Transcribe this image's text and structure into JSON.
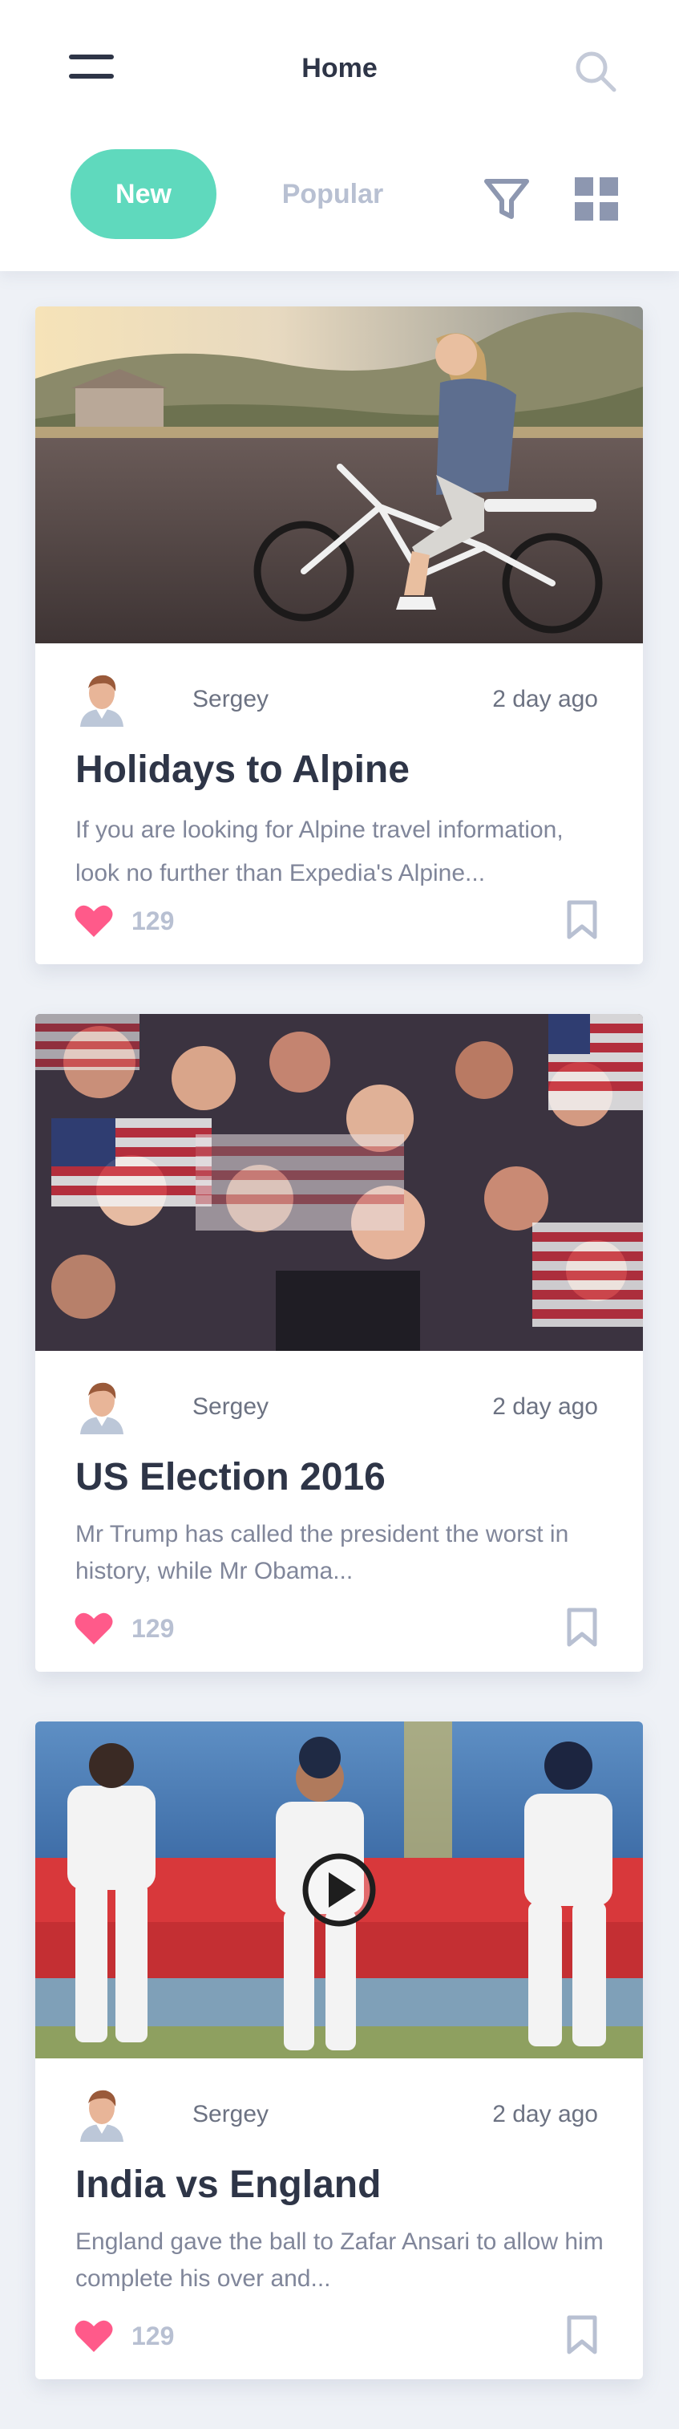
{
  "header": {
    "title": "Home",
    "menu_icon": "hamburger-menu-icon",
    "search_icon": "search-icon",
    "tabs": [
      {
        "label": "New",
        "active": true
      },
      {
        "label": "Popular",
        "active": false
      }
    ],
    "filter_icon": "filter-icon",
    "grid_icon": "grid-view-icon"
  },
  "colors": {
    "accent": "#5fd9bd",
    "heart": "#ff5a8a",
    "muted": "#b8c0d2",
    "text": "#2e3547"
  },
  "feed": {
    "posts": [
      {
        "author": "Sergey",
        "time": "2 day ago",
        "title": "Holidays to Alpine",
        "excerpt": "If you are looking for Alpine travel information, look no further than Expedia's Alpine...",
        "likes": "129",
        "image": "girl-on-bicycle-photo",
        "has_video": false
      },
      {
        "author": "Sergey",
        "time": "2 day ago",
        "title": "US Election 2016",
        "excerpt": "Mr Trump has called the president the worst in history, while Mr Obama...",
        "likes": "129",
        "image": "crowd-with-us-flags-photo",
        "has_video": false
      },
      {
        "author": "Sergey",
        "time": "2 day ago",
        "title": "India vs England",
        "excerpt": "England gave the ball to Zafar Ansari to allow him complete his over and...",
        "likes": "129",
        "image": "cricket-players-photo",
        "has_video": true
      }
    ]
  }
}
